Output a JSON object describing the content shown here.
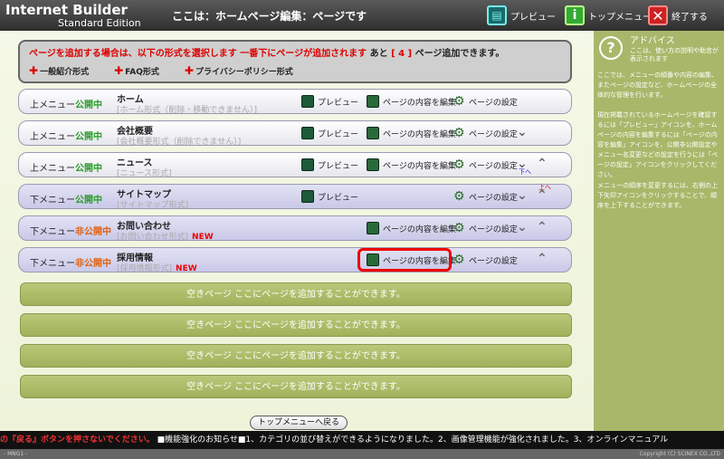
{
  "header": {
    "logo_main": "Internet Builder",
    "logo_sub": "Standard Edition",
    "page_title": "ここは：ホームページ編集：ページです",
    "preview_label": "プレビュー",
    "top_menu_label": "トップメニュー",
    "end_label": "終了する"
  },
  "info": {
    "line1_prefix": "ページを追加する場合は、以下の形式を選択します 一番下にページが追加されます",
    "line1_ato": "あと",
    "line1_count": "[ 4 ]",
    "line1_suffix": "ページ追加できます。",
    "links": [
      "一般紹介形式",
      "FAQ形式",
      "プライバシーポリシー形式"
    ]
  },
  "labels": {
    "preview": "プレビュー",
    "edit_content": "ページの内容を編集",
    "page_settings": "ページの設定",
    "new": "NEW",
    "up_annot": "上へ",
    "down_annot": "下へ"
  },
  "pages": [
    {
      "menu": "上メニュー",
      "status": "公開中",
      "name": "ホーム",
      "format": "[ホーム形式（削除・移動できません）]"
    },
    {
      "menu": "上メニュー",
      "status": "公開中",
      "name": "会社概要",
      "format": "[会社概要形式（削除できません）]"
    },
    {
      "menu": "上メニュー",
      "status": "公開中",
      "name": "ニュース",
      "format": "[ニュース形式]"
    },
    {
      "menu": "下メニュー",
      "status": "公開中",
      "name": "サイトマップ",
      "format": "[サイトマップ形式]"
    },
    {
      "menu": "下メニュー",
      "status": "非公開中",
      "name": "お問い合わせ",
      "format": "[お問い合わせ形式]"
    },
    {
      "menu": "下メニュー",
      "status": "非公開中",
      "name": "採用情報",
      "format": "[採用情報形式]"
    }
  ],
  "empty_slot_text": "空きページ ここにページを追加することができます。",
  "back_button": "トップメニューへ戻る",
  "sidebar": {
    "title": "アドバイス",
    "subtitle": "ここは、使い方の説明や助言が表示されます",
    "p1": "ここでは、メニューの順番や内容の編集、またページの設定など、ホームページの全体的な管理を行います。",
    "p2": "現在掲載されているホームページを確認するには「プレビュー」アイコンを、ホームページの内容を編集するには「ページの内容を編集」アイコンを、公開非公開設定やメニュー名変更などの設定を行うには「ページの設定」アイコンをクリックしてください。",
    "p3": "メニューの順序を変更するには、右側の上下矢印アイコンをクリックすることで、順序を上下することができます。"
  },
  "ticker": {
    "warn": "の『戻る』ボタンを押さないでください。",
    "news": "■機能強化のお知らせ■1、カテゴリの並び替えができるようになりました。2、画像管理機能が強化されました。3、オンラインマニュアル"
  },
  "footer": {
    "version": "- MNG1 -",
    "copyright": "Copyright (C) SCINEX CO.,LTD"
  }
}
